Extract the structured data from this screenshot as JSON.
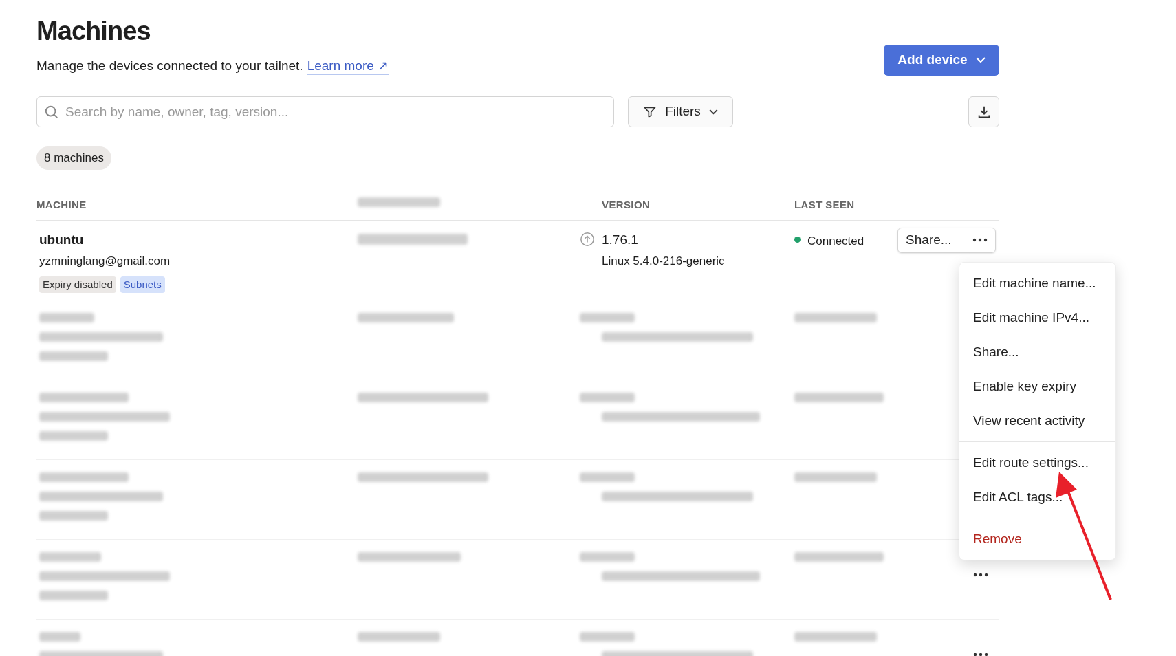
{
  "header": {
    "title": "Machines",
    "description": "Manage the devices connected to your tailnet.",
    "link": "Learn more ↗",
    "add_button": "Add device"
  },
  "search": {
    "placeholder": "Search by name, owner, tag, version..."
  },
  "filters_button": "Filters",
  "count_badge": "8 machines",
  "table": {
    "columns": [
      {
        "kind": "label",
        "label": "MACHINE"
      },
      {
        "kind": "redacted"
      },
      {
        "kind": "label",
        "label": "VERSION"
      },
      {
        "kind": "label",
        "label": "LAST SEEN"
      }
    ],
    "rows": [
      {
        "kind": "machine",
        "name": "ubuntu",
        "owner": "yzmninglang@gmail.com",
        "tags": [
          {
            "label": "Expiry disabled",
            "kind": "neutral"
          },
          {
            "label": "Subnets",
            "kind": "accent"
          }
        ],
        "version": "1.76.1",
        "update_available": true,
        "os": "Linux 5.4.0-216-generic",
        "status": "Connected",
        "online": true,
        "share_button": "Share..."
      },
      {
        "kind": "redacted"
      },
      {
        "kind": "redacted"
      },
      {
        "kind": "redacted"
      },
      {
        "kind": "redacted",
        "actions_visible": true
      },
      {
        "kind": "redacted",
        "actions_visible": true
      }
    ]
  },
  "menu": {
    "groups": [
      [
        {
          "label": "Edit machine name...",
          "kind": "normal"
        },
        {
          "label": "Edit machine IPv4...",
          "kind": "normal"
        },
        {
          "label": "Share...",
          "kind": "normal"
        },
        {
          "label": "Enable key expiry",
          "kind": "normal"
        },
        {
          "label": "View recent activity",
          "kind": "normal"
        }
      ],
      [
        {
          "label": "Edit route settings...",
          "kind": "normal"
        },
        {
          "label": "Edit ACL tags...",
          "kind": "normal"
        }
      ],
      [
        {
          "label": "Remove",
          "kind": "danger"
        }
      ]
    ]
  },
  "annotation": {
    "kind": "arrow"
  }
}
